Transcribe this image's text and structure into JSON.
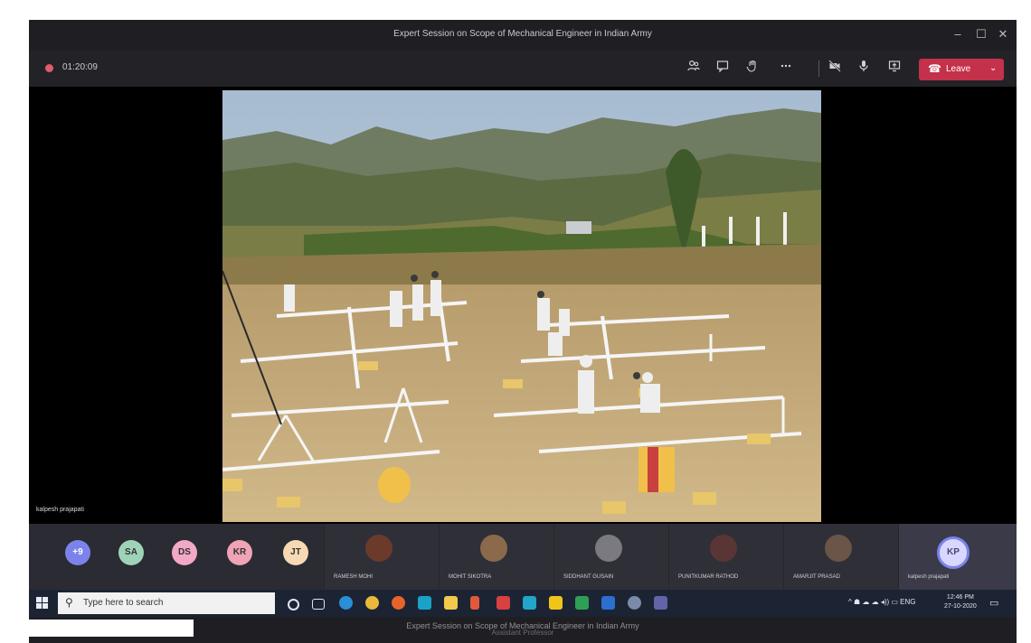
{
  "window": {
    "title": "Expert Session on Scope of Mechanical Engineer in Indian Army",
    "controls": [
      "–",
      "☐",
      "✕"
    ]
  },
  "toolbar": {
    "timer": "01:20:09",
    "leave_label": "Leave",
    "buttons": [
      "people-icon",
      "chat-icon",
      "raise-hand-icon",
      "more-icon",
      "camera-off-icon",
      "mic-icon",
      "share-screen-icon"
    ]
  },
  "stage": {
    "speaker_name": "kalpesh prajapati"
  },
  "participants": {
    "overflow_count": "+9",
    "initials": [
      {
        "text": "SA",
        "color": "#9fd3b8"
      },
      {
        "text": "DS",
        "color": "#f3a8c7"
      },
      {
        "text": "KR",
        "color": "#f0a3b5"
      },
      {
        "text": "JT",
        "color": "#f7d9b3"
      }
    ],
    "tiles": [
      {
        "name": "RAMESH MOHI",
        "face": "#6b3a2a"
      },
      {
        "name": "MOHIT SIKOTRA",
        "face": "#8a6a4a"
      },
      {
        "name": "SIDDHANT GUSAIN",
        "face": "#7a7a80"
      },
      {
        "name": "PUNITKUMAR RATHOD",
        "face": "#5a3535"
      },
      {
        "name": "AMARJIT PRASAD",
        "face": "#6a5548"
      }
    ],
    "self": {
      "initials": "KP",
      "name": "kalpesh prajapati"
    }
  },
  "taskbar": {
    "search_placeholder": "Type here to search",
    "tray_text": "^  ☗  ☁  ☁  ◂))  ▭  ENG",
    "time": "12:46 PM",
    "date": "27-10-2020"
  },
  "bottom": {
    "title": "Expert Session on Scope of Mechanical Engineer in Indian Army",
    "subtitle": "Assistant Professor"
  }
}
